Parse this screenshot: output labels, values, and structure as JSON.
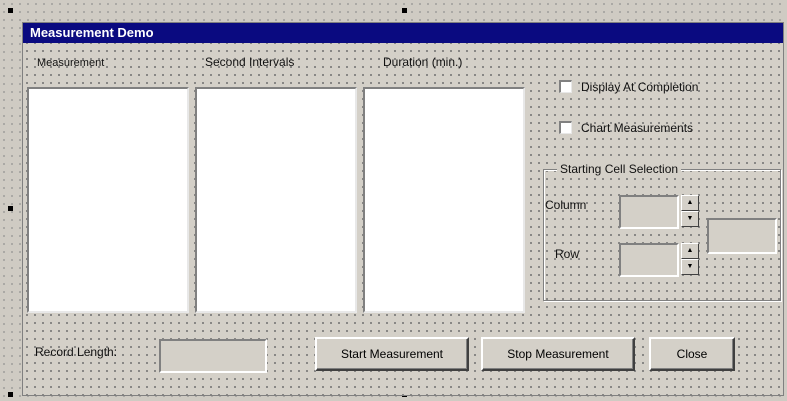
{
  "form": {
    "title": "Measurement Demo",
    "columns": [
      "Measurement",
      "Second Intervals",
      "Duration (min.)"
    ],
    "checkboxes": [
      {
        "label": "Display At Completion",
        "checked": false
      },
      {
        "label": "Chart Measurements",
        "checked": false
      }
    ],
    "starting_cell": {
      "frame_label": "Starting Cell Selection",
      "column_label": "Column",
      "row_label": "Row",
      "column_value": "",
      "row_value": "",
      "cell_value": ""
    },
    "record_length_label": "Record Length:",
    "record_length_value": "",
    "buttons": {
      "start": "Start Measurement",
      "stop": "Stop Measurement",
      "close": "Close"
    },
    "icons": {
      "spin_up": "▲",
      "spin_down": "▼"
    }
  }
}
